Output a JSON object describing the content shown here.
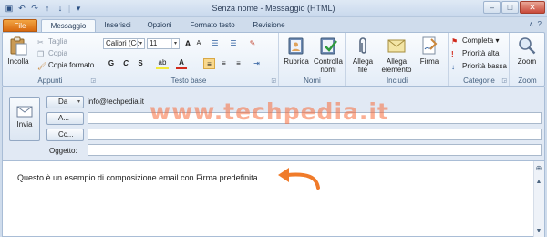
{
  "window": {
    "title": "Senza nome - Messaggio (HTML)",
    "minimize_icon": "minimize-icon",
    "maximize_icon": "maximize-icon",
    "close_icon": "close-icon"
  },
  "quick_access": [
    "save-icon",
    "undo-icon",
    "redo-icon",
    "up-icon",
    "down-icon",
    "customize-icon"
  ],
  "tabs": [
    {
      "label": "File"
    },
    {
      "label": "Messaggio"
    },
    {
      "label": "Inserisci"
    },
    {
      "label": "Opzioni"
    },
    {
      "label": "Formato testo"
    },
    {
      "label": "Revisione"
    }
  ],
  "ribbon": {
    "appunti": {
      "label": "Appunti",
      "paste": "Incolla",
      "cut": "Taglia",
      "copy": "Copia",
      "format_painter": "Copia formato"
    },
    "testo_base": {
      "label": "Testo base",
      "font": "Calibri (Cc",
      "size": "11",
      "grow": "A",
      "shrink": "A",
      "bullets": "☰",
      "numbering": "☰",
      "bold": "G",
      "italic": "C",
      "underline": "S",
      "highlight": "ab",
      "font_color": "A"
    },
    "nomi": {
      "label": "Nomi",
      "address_book": "Rubrica",
      "check_names": "Controlla nomi"
    },
    "includi": {
      "label": "Includi",
      "attach_file": "Allega file",
      "attach_item": "Allega elemento",
      "signature": "Firma"
    },
    "categorie": {
      "label": "Categorie",
      "follow_up": "Completa",
      "high_priority": "Priorità alta",
      "low_priority": "Priorità bassa"
    },
    "zoom": {
      "label": "Zoom",
      "zoom": "Zoom"
    }
  },
  "compose": {
    "send": "Invia",
    "from_button": "Da",
    "from_value": "info@techpedia.it",
    "to_button": "A...",
    "cc_button": "Cc...",
    "subject_label": "Oggetto:",
    "body_text": "Questo è un esempio di composizione email con Firma predefinita"
  },
  "watermark": "www.techpedia.it",
  "colors": {
    "file_tab": "#e07a1a",
    "arrow": "#f07b2a",
    "ribbon_bg": "#e3ecf7"
  }
}
